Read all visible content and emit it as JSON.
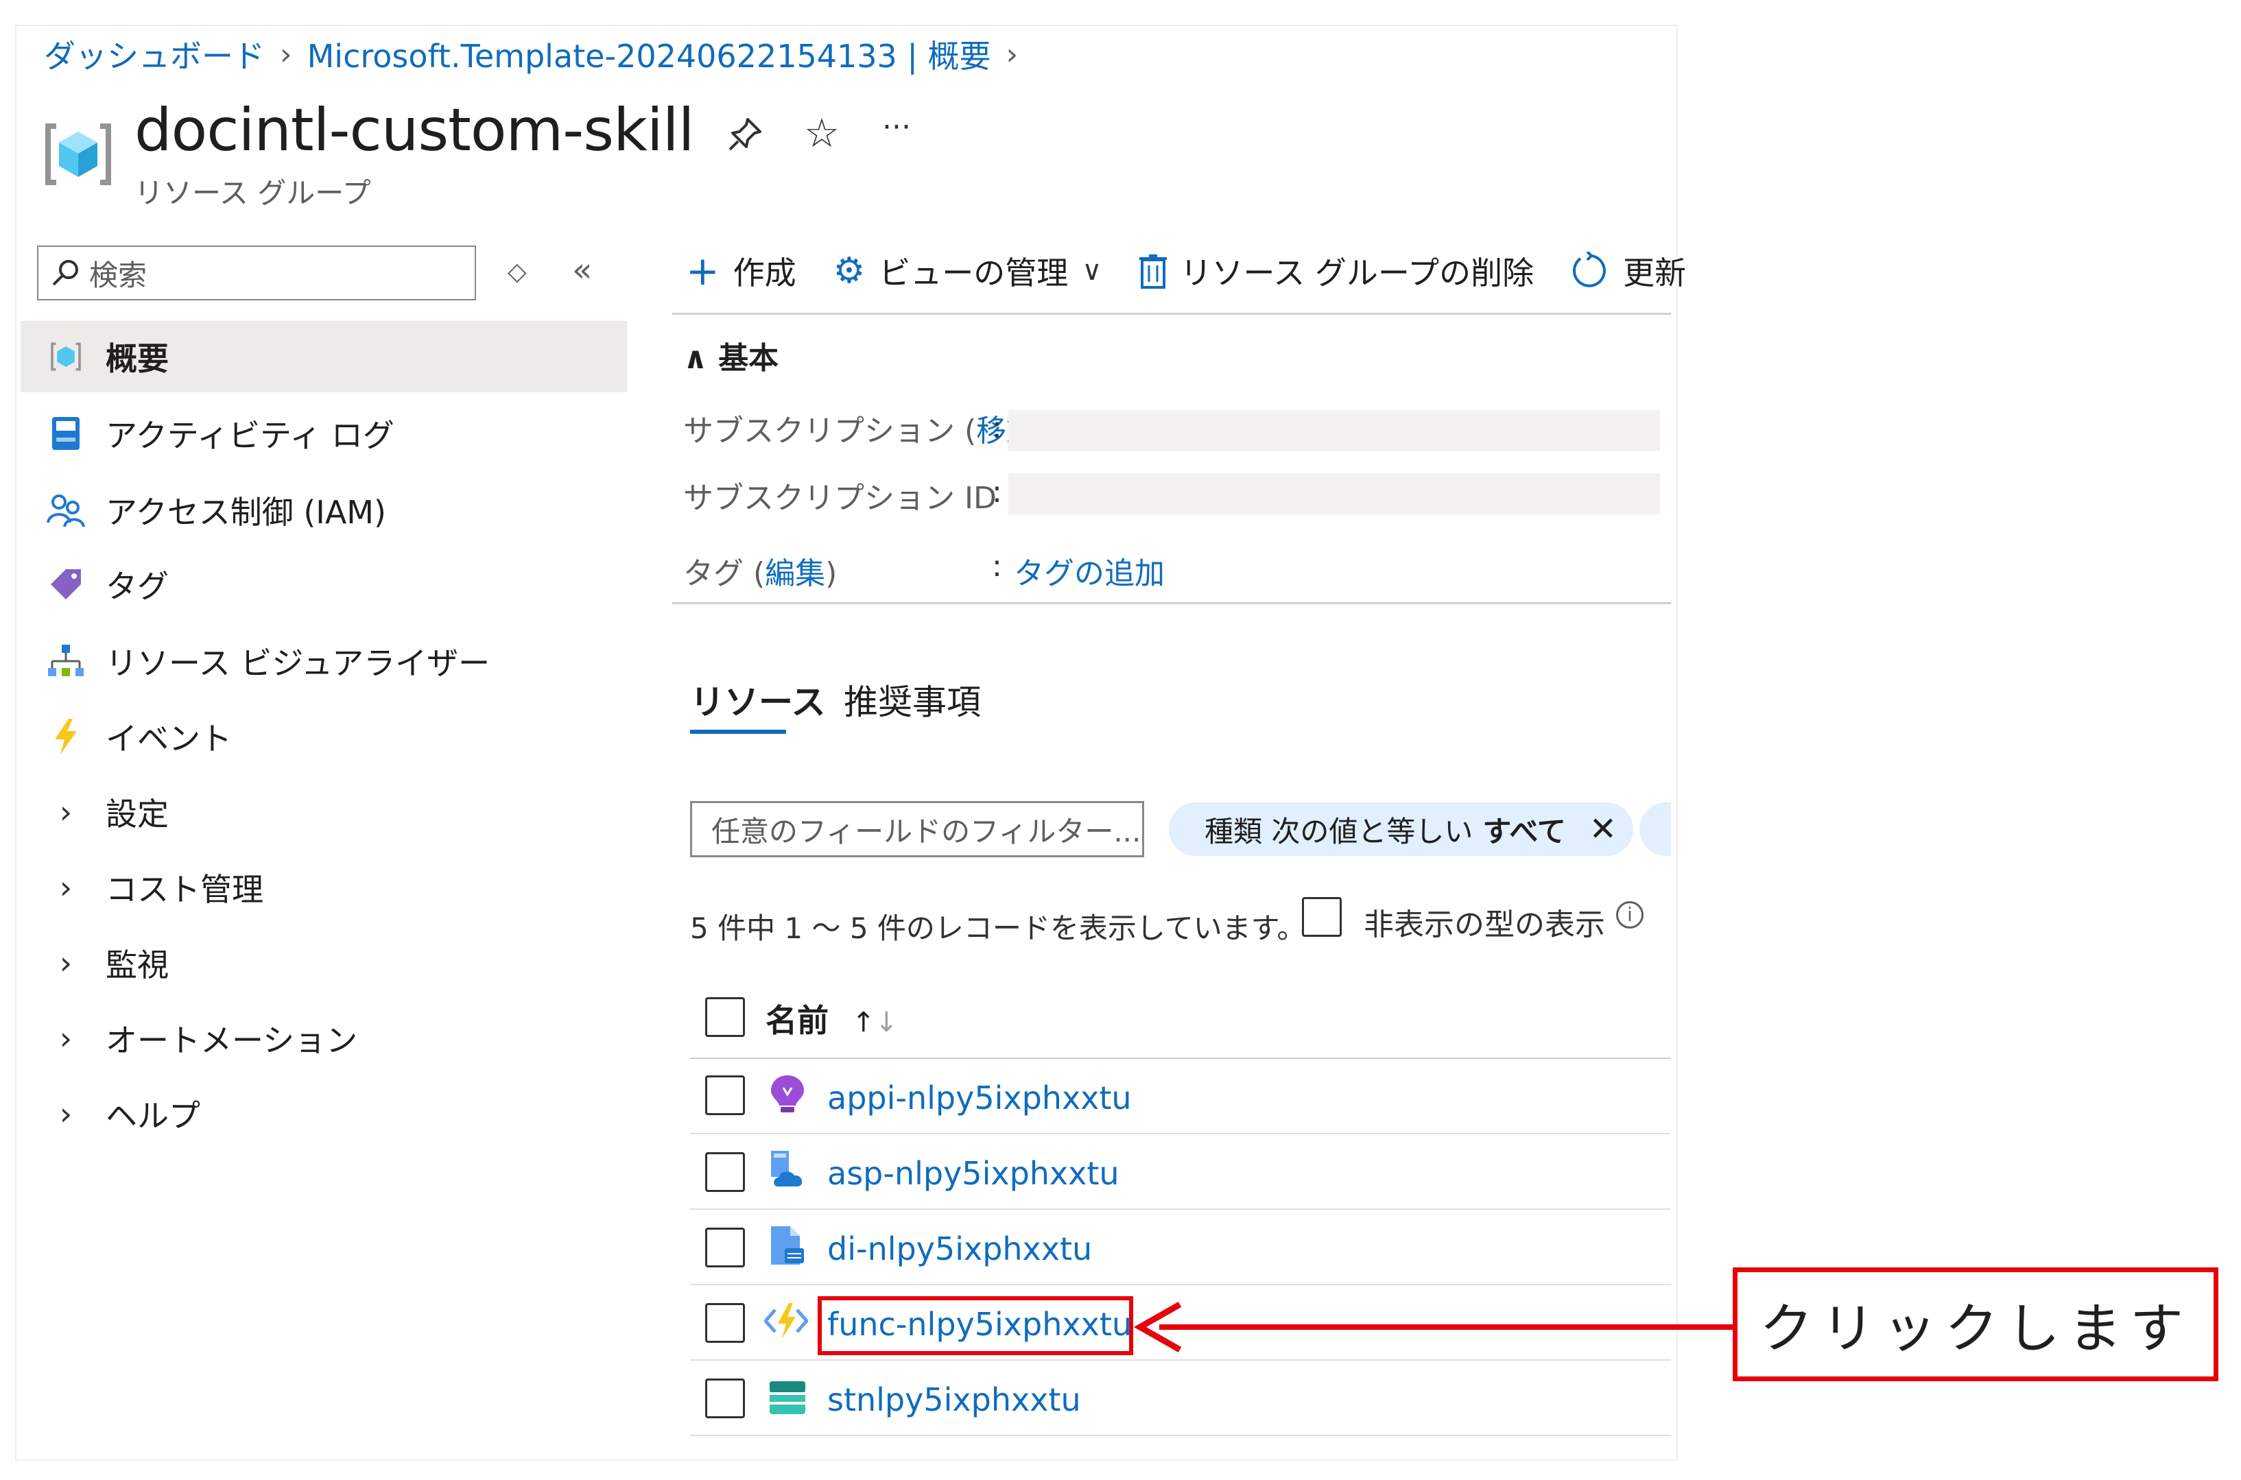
{
  "breadcrumb": {
    "dashboard": "ダッシュボード",
    "deployment": "Microsoft.Template-20240622154133 | 概要"
  },
  "header": {
    "title": "docintl-custom-skill",
    "subtitle": "リソース グループ"
  },
  "search": {
    "placeholder": "検索"
  },
  "sidebar": {
    "items": [
      {
        "label": "概要",
        "icon": "resource-group-icon"
      },
      {
        "label": "アクティビティ ログ",
        "icon": "activity-log-icon"
      },
      {
        "label": "アクセス制御 (IAM)",
        "icon": "people-icon"
      },
      {
        "label": "タグ",
        "icon": "tag-icon"
      },
      {
        "label": "リソース ビジュアライザー",
        "icon": "visualizer-icon"
      },
      {
        "label": "イベント",
        "icon": "lightning-icon"
      },
      {
        "label": "設定",
        "icon": "chevron-right-icon"
      },
      {
        "label": "コスト管理",
        "icon": "chevron-right-icon"
      },
      {
        "label": "監視",
        "icon": "chevron-right-icon"
      },
      {
        "label": "オートメーション",
        "icon": "chevron-right-icon"
      },
      {
        "label": "ヘルプ",
        "icon": "chevron-right-icon"
      }
    ]
  },
  "toolbar": {
    "create": "作成",
    "manage_view": "ビューの管理",
    "delete_rg": "リソース グループの削除",
    "refresh": "更新"
  },
  "essentials": {
    "section_title": "基本",
    "subscription_label": "サブスクリプション",
    "move_link": "移動",
    "subscription_id_label": "サブスクリプション ID",
    "tags_label": "タグ",
    "edit_link": "編集",
    "add_tag_link": "タグの追加"
  },
  "tabs": {
    "resources": "リソース",
    "recommendations": "推奨事項"
  },
  "filter": {
    "placeholder": "任意のフィールドのフィルター...",
    "pill_prefix": "種類 次の値と等しい",
    "pill_value": "すべて"
  },
  "records": {
    "summary": "5 件中 1 ～ 5 件のレコードを表示しています。",
    "show_hidden": "非表示の型の表示"
  },
  "table": {
    "name_header": "名前",
    "rows": [
      {
        "name": "appi-nlpy5ixphxxtu",
        "icon": "app-insights-icon"
      },
      {
        "name": "asp-nlpy5ixphxxtu",
        "icon": "app-service-plan-icon"
      },
      {
        "name": "di-nlpy5ixphxxtu",
        "icon": "document-intelligence-icon"
      },
      {
        "name": "func-nlpy5ixphxxtu",
        "icon": "function-app-icon"
      },
      {
        "name": "stnlpy5ixphxxtu",
        "icon": "storage-account-icon"
      }
    ]
  },
  "callout": {
    "text": "クリックします",
    "color": "#e8000b"
  }
}
